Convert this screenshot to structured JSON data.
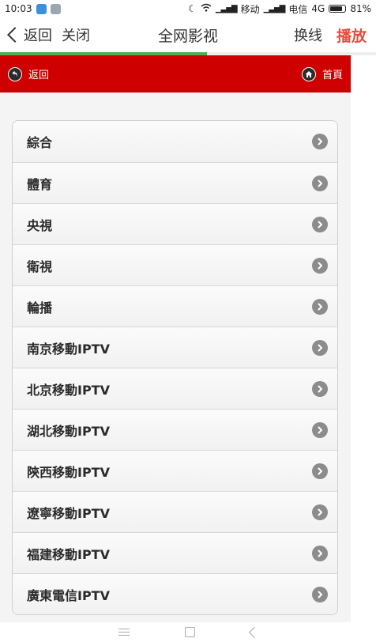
{
  "status_bar": {
    "time": "10:03",
    "carrier1": "移动",
    "carrier2": "电信",
    "network": "4G",
    "battery": "81%",
    "battery_level": 0.81,
    "icons": [
      "app-icon-blue",
      "app-icon-gray",
      "moon-icon",
      "wifi-icon",
      "signal-icon",
      "battery-icon"
    ]
  },
  "titlebar": {
    "back_label": "返回",
    "close_label": "关闭",
    "title": "全网影视",
    "switch_label": "换线",
    "play_label": "播放"
  },
  "progress": {
    "value": 0.55
  },
  "subnav": {
    "back_label": "返回",
    "home_label": "首頁"
  },
  "menu": {
    "items": [
      {
        "label": "綜合"
      },
      {
        "label": "體育"
      },
      {
        "label": "央視"
      },
      {
        "label": "衛視"
      },
      {
        "label": "輪播"
      },
      {
        "label": "南京移動IPTV"
      },
      {
        "label": "北京移動IPTV"
      },
      {
        "label": "湖北移動IPTV"
      },
      {
        "label": "陝西移動IPTV"
      },
      {
        "label": "遼寧移動IPTV"
      },
      {
        "label": "福建移動IPTV"
      },
      {
        "label": "廣東電信IPTV"
      }
    ]
  },
  "colors": {
    "header_red": "#cf0000",
    "play_red": "#e84b3c",
    "progress_green": "#4caf50"
  }
}
